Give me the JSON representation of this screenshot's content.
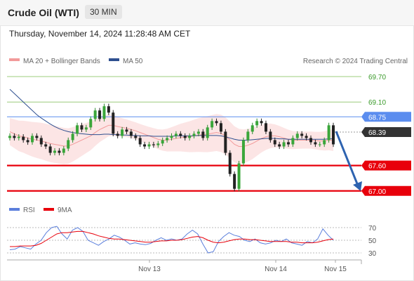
{
  "header": {
    "title": "Crude Oil (WTI)",
    "interval": "30 MIN"
  },
  "timestamp": "Thursday, November 14, 2024 11:28:48 AM CET",
  "copyright": "Research © 2024 Trading Central",
  "colors": {
    "ma20": "#f29a9a",
    "ma50": "#2e4f8f",
    "bands": "#fbe0e0",
    "resistance": "#9ccc7c",
    "pivot": "#5b8def",
    "support": "#e8000b",
    "rsi": "#5b7fdc",
    "rsi_ma": "#e8000b",
    "last": "#333333"
  },
  "chart_data": [
    {
      "type": "line",
      "title": "",
      "legend": [
        {
          "name": "MA 20 + Bollinger Bands"
        },
        {
          "name": "MA 50"
        }
      ],
      "legend_placement": "top-left",
      "ylim": [
        66.88,
        69.85
      ],
      "x_tick_labels": [
        "Nov 13",
        "Nov 14",
        "Nov 15"
      ],
      "levels": [
        {
          "value": 69.7,
          "label": "69.70",
          "role": "resistance"
        },
        {
          "value": 69.1,
          "label": "69.10",
          "role": "resistance"
        },
        {
          "value": 68.75,
          "label": "68.75",
          "role": "pivot"
        },
        {
          "value": 68.39,
          "label": "68.39",
          "role": "last"
        },
        {
          "value": 67.6,
          "label": "67.60",
          "role": "support"
        },
        {
          "value": 67.0,
          "label": "67.00",
          "role": "support"
        }
      ],
      "close": [
        68.3,
        68.25,
        68.28,
        68.2,
        68.15,
        68.3,
        68.25,
        68.1,
        68.05,
        67.9,
        67.95,
        67.9,
        68.0,
        68.2,
        68.35,
        68.55,
        68.45,
        68.5,
        68.7,
        68.9,
        68.7,
        69.0,
        68.85,
        68.35,
        68.3,
        68.45,
        68.4,
        68.3,
        68.25,
        68.1,
        68.05,
        68.1,
        68.08,
        68.12,
        68.2,
        68.25,
        68.3,
        68.35,
        68.3,
        68.25,
        68.3,
        68.35,
        68.4,
        68.25,
        68.5,
        68.65,
        68.6,
        68.4,
        67.9,
        67.4,
        67.05,
        67.65,
        68.2,
        68.4,
        68.55,
        68.65,
        68.6,
        68.4,
        68.2,
        68.1,
        68.05,
        68.15,
        68.1,
        68.25,
        68.35,
        68.3,
        68.25,
        68.15,
        68.1,
        68.1,
        68.2,
        68.55,
        68.1
      ],
      "open": [
        68.25,
        68.3,
        68.25,
        68.28,
        68.2,
        68.15,
        68.3,
        68.25,
        68.1,
        68.05,
        67.9,
        67.95,
        67.9,
        68.0,
        68.2,
        68.35,
        68.55,
        68.45,
        68.5,
        68.7,
        68.9,
        68.7,
        69.0,
        68.85,
        68.35,
        68.3,
        68.45,
        68.4,
        68.3,
        68.25,
        68.1,
        68.05,
        68.1,
        68.08,
        68.12,
        68.2,
        68.25,
        68.3,
        68.35,
        68.3,
        68.25,
        68.3,
        68.35,
        68.4,
        68.25,
        68.5,
        68.65,
        68.6,
        68.4,
        67.9,
        67.4,
        67.05,
        67.65,
        68.2,
        68.4,
        68.55,
        68.65,
        68.6,
        68.4,
        68.2,
        68.1,
        68.05,
        68.15,
        68.1,
        68.25,
        68.35,
        68.3,
        68.25,
        68.15,
        68.1,
        68.1,
        68.2,
        68.55
      ],
      "ma20": [
        68.4,
        68.35,
        68.3,
        68.28,
        68.25,
        68.22,
        68.2,
        68.18,
        68.15,
        68.12,
        68.1,
        68.08,
        68.06,
        68.06,
        68.1,
        68.15,
        68.2,
        68.25,
        68.3,
        68.38,
        68.45,
        68.5,
        68.55,
        68.55,
        68.52,
        68.5,
        68.48,
        68.45,
        68.42,
        68.38,
        68.34,
        68.3,
        68.26,
        68.22,
        68.2,
        68.2,
        68.22,
        68.24,
        68.26,
        68.27,
        68.28,
        68.3,
        68.32,
        68.33,
        68.34,
        68.36,
        68.38,
        68.36,
        68.3,
        68.2,
        68.1,
        68.05,
        68.05,
        68.08,
        68.12,
        68.18,
        68.24,
        68.28,
        68.3,
        68.3,
        68.28,
        68.25,
        68.22,
        68.2,
        68.2,
        68.2,
        68.2,
        68.2,
        68.19,
        68.18,
        68.18,
        68.2,
        68.2
      ],
      "ma50": [
        69.4,
        69.3,
        69.2,
        69.1,
        69.0,
        68.9,
        68.8,
        68.72,
        68.65,
        68.58,
        68.52,
        68.47,
        68.43,
        68.4,
        68.38,
        68.36,
        68.35,
        68.34,
        68.33,
        68.33,
        68.33,
        68.34,
        68.34,
        68.33,
        68.33,
        68.32,
        68.32,
        68.31,
        68.31,
        68.3,
        68.3,
        68.3,
        68.29,
        68.29,
        68.29,
        68.29,
        68.29,
        68.3,
        68.3,
        68.3,
        68.3,
        68.3,
        68.31,
        68.31,
        68.31,
        68.31,
        68.31,
        68.3,
        68.28,
        68.25,
        68.22,
        68.2,
        68.2,
        68.2,
        68.21,
        68.22,
        68.23,
        68.24,
        68.24,
        68.24,
        68.23,
        68.23,
        68.22,
        68.22,
        68.22,
        68.22,
        68.22,
        68.22,
        68.22,
        68.22,
        68.22,
        68.23,
        68.23
      ]
    },
    {
      "type": "line",
      "title": "",
      "legend": [
        {
          "name": "RSI"
        },
        {
          "name": "9MA"
        }
      ],
      "legend_placement": "top-left",
      "ylim": [
        20,
        80
      ],
      "y_ticks": [
        70,
        50,
        30
      ],
      "rsi": [
        35,
        36,
        40,
        38,
        36,
        44,
        50,
        62,
        70,
        72,
        60,
        52,
        66,
        70,
        64,
        50,
        46,
        42,
        48,
        52,
        58,
        55,
        50,
        44,
        46,
        44,
        43,
        45,
        50,
        54,
        50,
        52,
        50,
        52,
        60,
        66,
        60,
        44,
        30,
        32,
        48,
        56,
        62,
        58,
        56,
        50,
        48,
        52,
        46,
        44,
        46,
        50,
        48,
        52,
        46,
        44,
        42,
        48,
        46,
        52,
        68,
        58,
        50
      ],
      "rsi_ma": [
        40,
        40,
        41,
        41,
        41,
        42,
        45,
        50,
        55,
        60,
        62,
        62,
        63,
        64,
        64,
        62,
        60,
        57,
        55,
        53,
        52,
        52,
        51,
        50,
        49,
        48,
        47,
        47,
        48,
        49,
        49,
        50,
        50,
        51,
        53,
        55,
        56,
        54,
        50,
        47,
        46,
        47,
        49,
        51,
        52,
        52,
        51,
        51,
        50,
        49,
        48,
        48,
        48,
        48,
        47,
        47,
        46,
        46,
        46,
        47,
        49,
        51,
        52
      ]
    }
  ]
}
